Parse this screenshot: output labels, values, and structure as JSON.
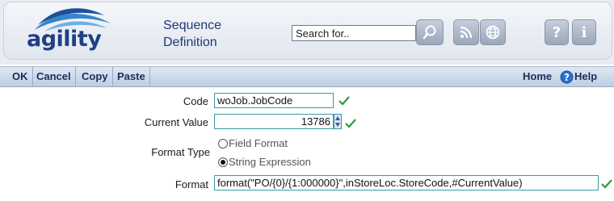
{
  "header": {
    "logo_text": "agility",
    "title_line1": "Sequence",
    "title_line2": "Definition",
    "search_placeholder": "Search for..",
    "buttons": [
      "search-icon",
      "rss-icon",
      "globe-icon",
      "help-icon",
      "info-icon"
    ]
  },
  "toolbar": {
    "ok": "OK",
    "cancel": "Cancel",
    "copy": "Copy",
    "paste": "Paste",
    "home": "Home",
    "help": "Help"
  },
  "form": {
    "code_label": "Code",
    "code_value": "woJob.JobCode",
    "current_value_label": "Current Value",
    "current_value": "13786",
    "format_type_label": "Format Type",
    "format_type_options": [
      "Field Format",
      "String Expression"
    ],
    "format_type_selected": "String Expression",
    "format_label": "Format",
    "format_value": "format(\"PO/{0}/{1:000000}\",inStoreLoc.StoreCode,#CurrentValue)"
  },
  "colors": {
    "brand_blue": "#1f3f86",
    "accent_teal": "#3a9aa8",
    "check_green": "#2f9a3a"
  }
}
